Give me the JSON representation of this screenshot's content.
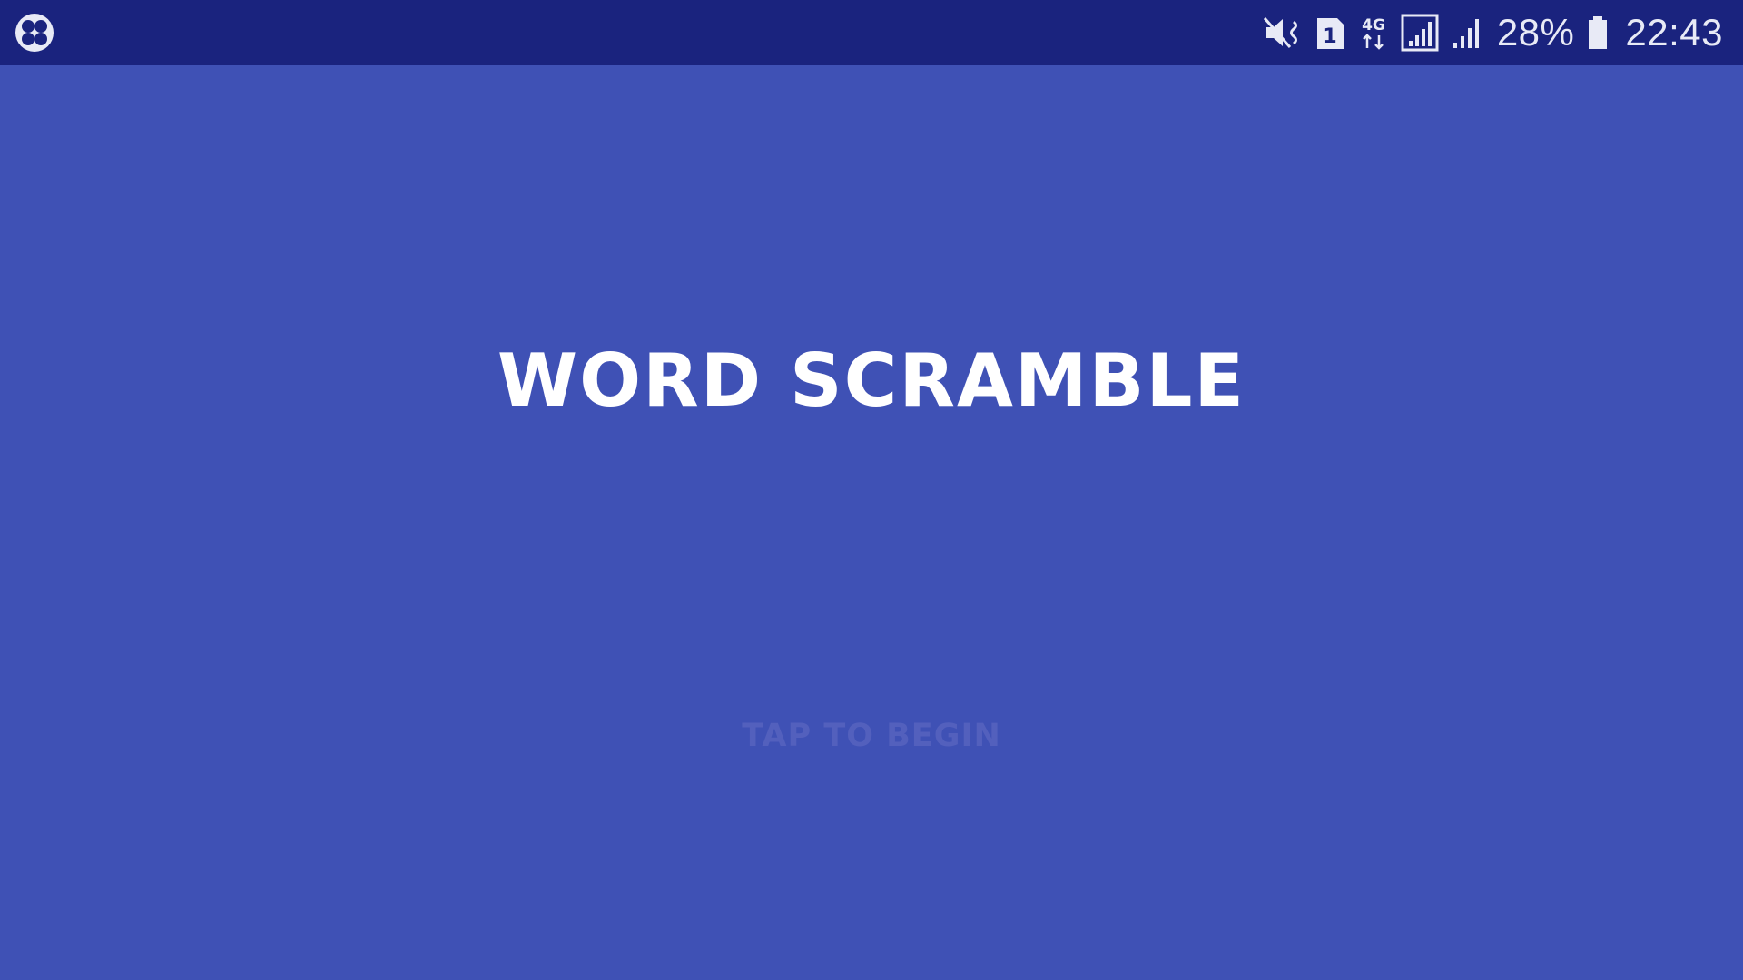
{
  "status_bar": {
    "left_icon": "game-launcher-icon",
    "icons": [
      "mute-vibrate-icon",
      "sim-1-icon",
      "4g-data-icon",
      "signal-sim1-icon",
      "signal-sim2-icon",
      "battery-icon"
    ],
    "sim_label": "1",
    "network_label": "4G",
    "battery_percent": "28%",
    "battery_level": 0.28,
    "time": "22:43",
    "background_color": "#1a237e"
  },
  "game": {
    "title": "WORD SCRAMBLE",
    "prompt": "TAP TO BEGIN",
    "background_color": "#3f51b5",
    "prompt_color": "#5360bd"
  }
}
